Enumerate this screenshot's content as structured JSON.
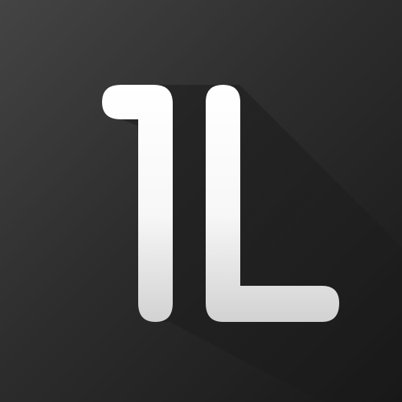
{
  "logo": {
    "text": "1L",
    "icon": "1l-monogram-icon"
  }
}
